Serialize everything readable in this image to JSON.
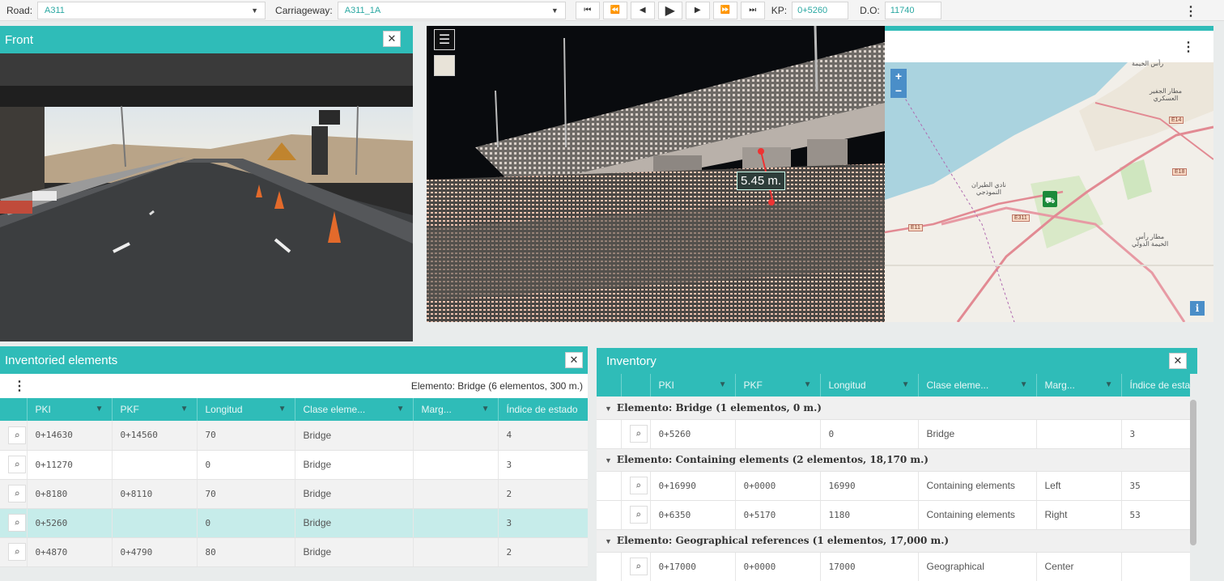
{
  "toolbar": {
    "road_label": "Road:",
    "road_value": "A311",
    "carriageway_label": "Carriageway:",
    "carriageway_value": "A311_1A",
    "kp_label": "KP:",
    "kp_value": "0+5260",
    "do_label": "D.O:",
    "do_value": "11740",
    "buttons": [
      "skip-back",
      "rewind",
      "step-back",
      "play",
      "step-forward",
      "fast-forward",
      "skip-forward"
    ]
  },
  "front_panel": {
    "title": "Front"
  },
  "point_cloud": {
    "measurement": "5.45 m."
  },
  "map": {
    "zoom_in": "+",
    "zoom_out": "−",
    "info": "i",
    "labels": {
      "city_top": "رأس الخيمة",
      "airport_1": "مطار الجفير\nالعسكري",
      "airport_2": "نادي الطيران\nالنموذجي",
      "airport_3": "مطار رأس\nالخيمة الدولي"
    },
    "shields": [
      "E14",
      "E18",
      "E311",
      "E11"
    ]
  },
  "inventoried": {
    "title": "Inventoried elements",
    "summary": "Elemento: Bridge (6 elementos, 300 m.)",
    "columns": [
      "PKI",
      "PKF",
      "Longitud",
      "Clase eleme...",
      "Marg...",
      "Índice de estado"
    ],
    "rows": [
      {
        "pki": "0+14630",
        "pkf": "0+14560",
        "longitud": "70",
        "clase": "Bridge",
        "marg": "",
        "indice": "4"
      },
      {
        "pki": "0+11270",
        "pkf": "",
        "longitud": "0",
        "clase": "Bridge",
        "marg": "",
        "indice": "3"
      },
      {
        "pki": "0+8180",
        "pkf": "0+8110",
        "longitud": "70",
        "clase": "Bridge",
        "marg": "",
        "indice": "2"
      },
      {
        "pki": "0+5260",
        "pkf": "",
        "longitud": "0",
        "clase": "Bridge",
        "marg": "",
        "indice": "3"
      },
      {
        "pki": "0+4870",
        "pkf": "0+4790",
        "longitud": "80",
        "clase": "Bridge",
        "marg": "",
        "indice": "2"
      }
    ]
  },
  "inventory": {
    "title": "Inventory",
    "columns": [
      "PKI",
      "PKF",
      "Longitud",
      "Clase eleme...",
      "Marg...",
      "Índice de esta"
    ],
    "groups": [
      {
        "label": "Elemento: Bridge (1 elementos, 0 m.)"
      },
      {
        "label": "Elemento: Containing elements (2 elementos, 18,170 m.)"
      },
      {
        "label": "Elemento: Geographical references (1 elementos, 17,000 m.)"
      }
    ],
    "rows": [
      {
        "pki": "0+5260",
        "pkf": "",
        "longitud": "0",
        "clase": "Bridge",
        "marg": "",
        "indice": "3"
      },
      {
        "pki": "0+16990",
        "pkf": "0+0000",
        "longitud": "16990",
        "clase": "Containing elements",
        "marg": "Left",
        "indice": "35"
      },
      {
        "pki": "0+6350",
        "pkf": "0+5170",
        "longitud": "1180",
        "clase": "Containing elements",
        "marg": "Right",
        "indice": "53"
      },
      {
        "pki": "0+17000",
        "pkf": "0+0000",
        "longitud": "17000",
        "clase": "Geographical",
        "marg": "Center",
        "indice": ""
      }
    ]
  },
  "colors": {
    "accent": "#2fbcb8",
    "selected_row": "#c6ecea",
    "map_button": "#4a8ec8"
  }
}
